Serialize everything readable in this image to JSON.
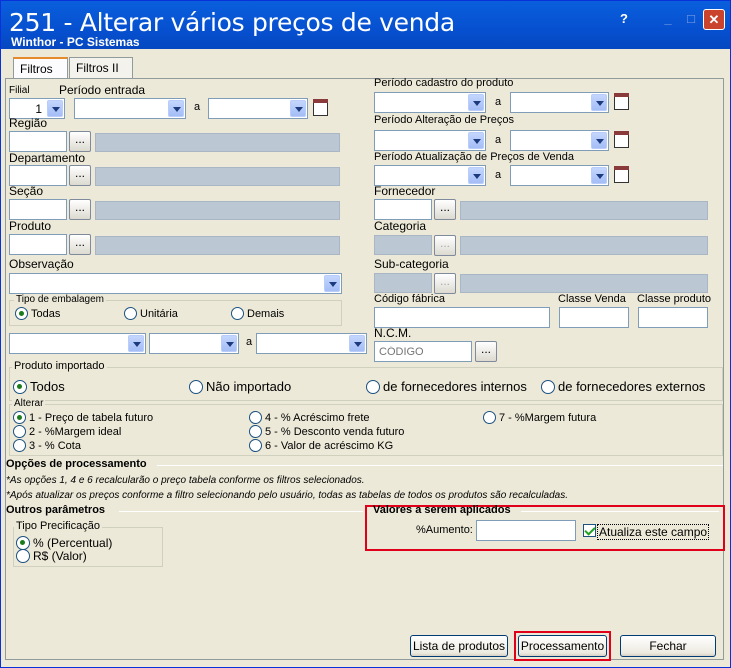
{
  "window": {
    "title": "251 - Alterar vários preços de venda",
    "subtitle": "Winthor - PC Sistemas",
    "help": "?",
    "minimize": "_",
    "maximize": "□",
    "close": "✕"
  },
  "tabs": [
    "Filtros",
    "Filtros II"
  ],
  "filters": {
    "filial_label": "Filial",
    "filial_value": "1",
    "periodo_entrada_label": "Período entrada",
    "a": "a",
    "regiao_label": "Região",
    "departamento_label": "Departamento",
    "secao_label": "Seção",
    "produto_label": "Produto",
    "observacao_label": "Observação",
    "periodo_cadastro_label": "Período cadastro do produto",
    "periodo_alteracao_label": "Período Alteração de Preços",
    "periodo_atualizacao_label": "Período Atualização de Preços de Venda",
    "fornecedor_label": "Fornecedor",
    "categoria_label": "Categoria",
    "subcategoria_label": "Sub-categoria",
    "codigo_fabrica_label": "Código fábrica",
    "classe_venda_label": "Classe Venda",
    "classe_produto_label": "Classe produto",
    "ncm_label": "N.C.M.",
    "ncm_placeholder": "CÓDIGO",
    "ellipsis": "..."
  },
  "embalagem": {
    "title": "Tipo de embalagem",
    "options": [
      "Todas",
      "Unitária",
      "Demais"
    ],
    "selected": 0
  },
  "produto_importado": {
    "title": "Produto importado",
    "options": [
      "Todos",
      "Não importado",
      "de fornecedores internos",
      "de fornecedores externos"
    ],
    "selected": 0
  },
  "alterar": {
    "title": "Alterar",
    "options": [
      "1 - Preço de tabela futuro",
      "2 - %Margem ideal",
      "3 - % Cota",
      "4 - % Acréscimo frete",
      "5 - % Desconto venda futuro",
      "6 - Valor de acréscimo KG",
      "7 - %Margem futura"
    ],
    "selected": 0
  },
  "opcoes": {
    "title": "Opções de processamento",
    "hint1": "*As opções 1, 4 e 6 recalcularão o preço tabela conforme os filtros selecionados.",
    "hint2": "*Após atualizar os preços conforme a filtro selecionando pelo usuário, todas as tabelas de todos os produtos são recalculadas."
  },
  "outros": {
    "title": "Outros parâmetros",
    "tipo_title": "Tipo Precificação",
    "options": [
      "% (Percentual)",
      "R$ (Valor)"
    ],
    "selected": 0
  },
  "valores": {
    "title": "Valores a serem aplicados",
    "aumento_label": "%Aumento:",
    "aumento_value": "",
    "atualiza_label": "Atualiza este campo",
    "atualiza_checked": true
  },
  "buttons": {
    "lista": "Lista de produtos",
    "processamento": "Processamento",
    "fechar": "Fechar"
  },
  "colors": {
    "highlight": "#e0001a",
    "titlebar": "#0650d0"
  }
}
